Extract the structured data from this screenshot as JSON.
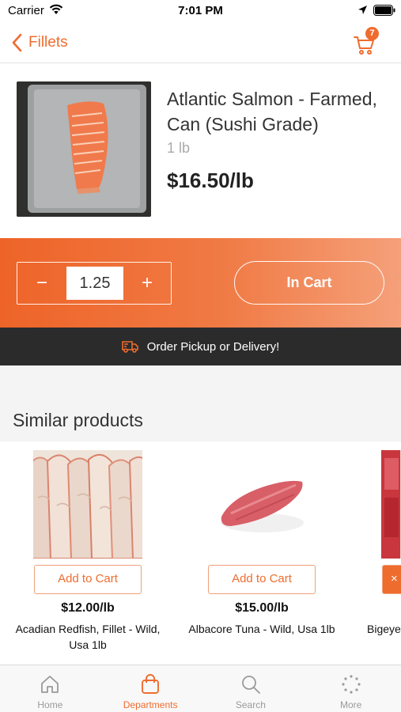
{
  "status_bar": {
    "carrier": "Carrier",
    "time": "7:01 PM"
  },
  "nav": {
    "back_label": "Fillets",
    "cart_count": "7",
    "accent_color": "#ef6c2f"
  },
  "product": {
    "name": "Atlantic Salmon - Farmed, Can (Sushi Grade)",
    "unit": "1 lb",
    "price": "$16.50/lb"
  },
  "cart_controls": {
    "minus_label": "−",
    "quantity": "1.25",
    "plus_label": "+",
    "in_cart_label": "In Cart"
  },
  "banner": {
    "icon": "delivery-truck-icon",
    "text": "Order Pickup or Delivery!"
  },
  "similar": {
    "title": "Similar products",
    "items": [
      {
        "add_label": "Add to Cart",
        "price": "$12.00/lb",
        "name": "Acadian Redfish, Fillet - Wild, Usa 1lb"
      },
      {
        "add_label": "Add to Cart",
        "price": "$15.00/lb",
        "name": "Albacore Tuna - Wild, Usa 1lb"
      },
      {
        "add_label": "Add to Cart",
        "price": "",
        "name": "Bigeye"
      }
    ]
  },
  "tabs": [
    {
      "label": "Home",
      "icon": "home-icon"
    },
    {
      "label": "Departments",
      "icon": "shopping-bag-icon"
    },
    {
      "label": "Search",
      "icon": "search-icon"
    },
    {
      "label": "More",
      "icon": "more-icon"
    }
  ]
}
